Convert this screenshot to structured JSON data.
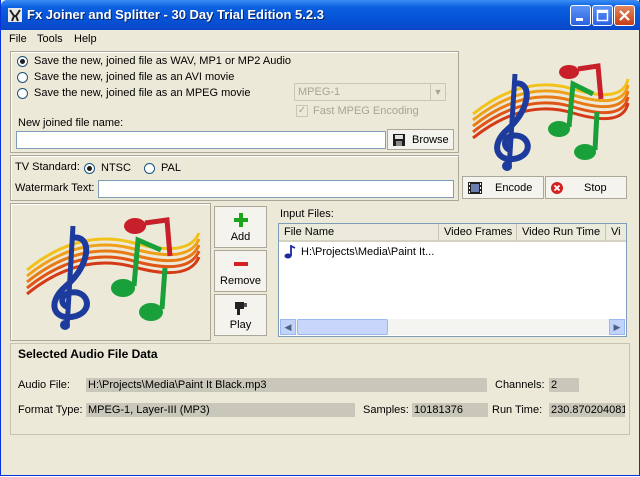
{
  "window": {
    "title": "Fx Joiner and Splitter - 30 Day Trial Edition 5.2.3"
  },
  "menu": [
    {
      "label": "File"
    },
    {
      "label": "Tools"
    },
    {
      "label": "Help"
    }
  ],
  "output": {
    "options": [
      {
        "label": "Save the new, joined file as WAV, MP1 or MP2 Audio",
        "checked": true
      },
      {
        "label": "Save the new, joined file as an AVI movie",
        "checked": false
      },
      {
        "label": "Save the new, joined file as an MPEG movie",
        "checked": false
      }
    ],
    "mpeg_format": "MPEG-1",
    "fast_encoding_label": "Fast MPEG Encoding",
    "new_file_label": "New joined file name:",
    "new_file_value": "",
    "browse_label": "Browse"
  },
  "tv": {
    "label": "TV Standard:",
    "ntsc": "NTSC",
    "pal": "PAL",
    "watermark_label": "Watermark Text:",
    "watermark_value": ""
  },
  "actions": {
    "encode": "Encode",
    "stop": "Stop"
  },
  "file_buttons": {
    "add": "Add",
    "remove": "Remove",
    "play": "Play"
  },
  "input_files": {
    "label": "Input Files:",
    "columns": [
      "File Name",
      "Video Frames",
      "Video Run Time",
      "Vi"
    ],
    "rows": [
      {
        "file_name": "H:\\Projects\\Media\\Paint It..."
      }
    ]
  },
  "selected": {
    "heading": "Selected Audio File Data",
    "audio_file_label": "Audio File:",
    "audio_file_value": "H:\\Projects\\Media\\Paint It Black.mp3",
    "channels_label": "Channels:",
    "channels_value": "2",
    "format_label": "Format Type:",
    "format_value": "MPEG-1, Layer-III (MP3)",
    "samples_label": "Samples:",
    "samples_value": "10181376",
    "runtime_label": "Run Time:",
    "runtime_value": "230.870204081"
  },
  "colors": {
    "title_bar": "#0a5fe0",
    "window_bg": "#ece9d8",
    "disabled_text": "#a7a597"
  },
  "icons": [
    "app-icon",
    "minimize-icon",
    "maximize-icon",
    "close-icon",
    "music-notes-image",
    "browse-disk-icon",
    "encode-film-icon",
    "stop-icon",
    "add-icon",
    "remove-icon",
    "play-icon",
    "music-note-icon"
  ]
}
